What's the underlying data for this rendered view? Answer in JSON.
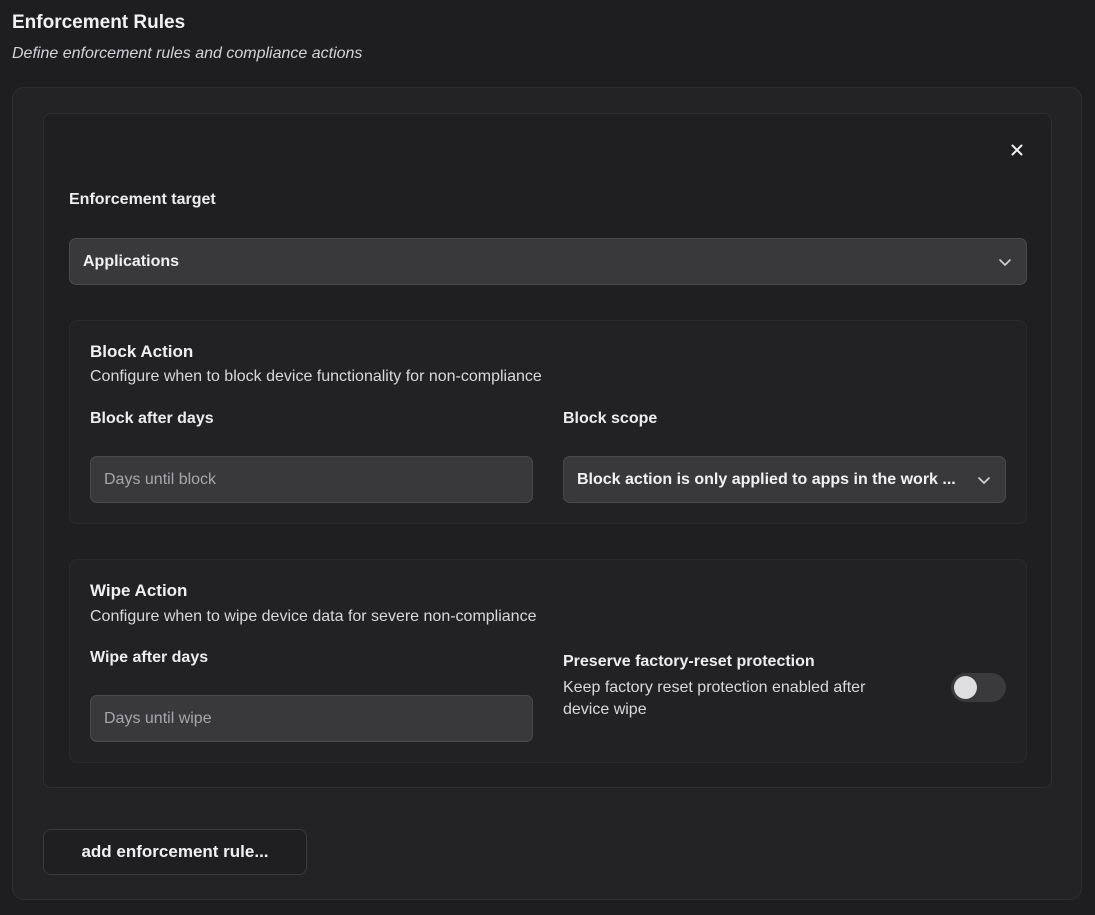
{
  "header": {
    "title": "Enforcement Rules",
    "subtitle": "Define enforcement rules and compliance actions"
  },
  "rule": {
    "close_icon": "close-icon",
    "target_label": "Enforcement target",
    "target_value": "Applications",
    "block_action": {
      "title": "Block Action",
      "description": "Configure when to block device functionality for non-compliance",
      "days_label": "Block after days",
      "days_placeholder": "Days until block",
      "scope_label": "Block scope",
      "scope_value": "Block action is only applied to apps in the work ..."
    },
    "wipe_action": {
      "title": "Wipe Action",
      "description": "Configure when to wipe device data for severe non-compliance",
      "days_label": "Wipe after days",
      "days_placeholder": "Days until wipe",
      "frp_label": "Preserve factory-reset protection",
      "frp_description_line1": "Keep factory reset protection enabled after",
      "frp_description_line2": "device wipe",
      "frp_enabled": false
    }
  },
  "footer": {
    "add_button_label": "add enforcement rule..."
  },
  "colors": {
    "background": "#1e1e20",
    "input_bg": "#39393c",
    "text": "#ececee",
    "placeholder": "#a7a7ab"
  }
}
